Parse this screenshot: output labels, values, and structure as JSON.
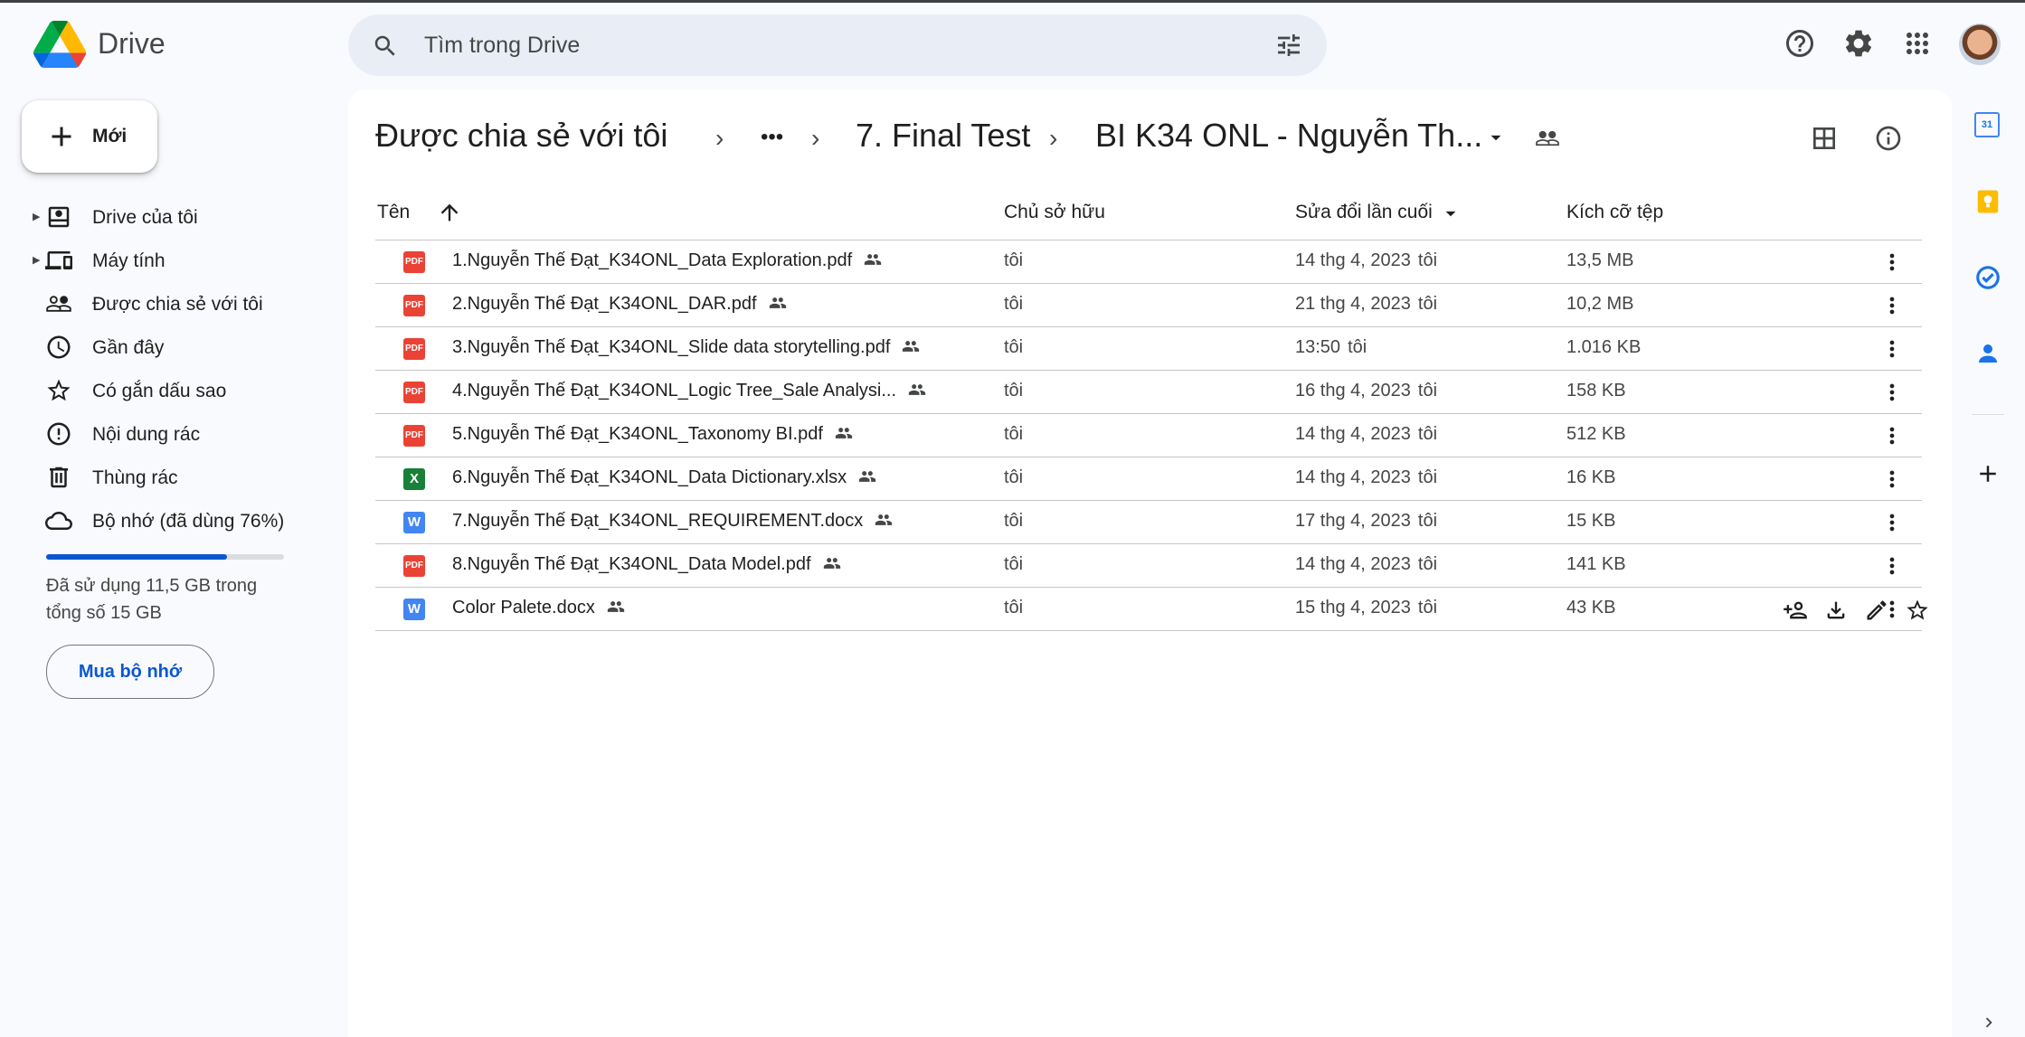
{
  "app": {
    "name": "Drive"
  },
  "search": {
    "placeholder": "Tìm trong Drive"
  },
  "header_icons": [
    "help-icon",
    "settings-icon",
    "apps-grid-icon",
    "account-avatar"
  ],
  "new_button": {
    "label": "Mới"
  },
  "sidebar": {
    "items": [
      {
        "label": "Drive của tôi",
        "icon": "my-drive-icon",
        "expandable": true
      },
      {
        "label": "Máy tính",
        "icon": "computers-icon",
        "expandable": true
      },
      {
        "label": "Được chia sẻ với tôi",
        "icon": "shared-icon",
        "expandable": false
      },
      {
        "label": "Gần đây",
        "icon": "clock-icon",
        "expandable": false
      },
      {
        "label": "Có gắn dấu sao",
        "icon": "star-icon",
        "expandable": false
      },
      {
        "label": "Nội dung rác",
        "icon": "spam-icon",
        "expandable": false
      },
      {
        "label": "Thùng rác",
        "icon": "trash-icon",
        "expandable": false
      },
      {
        "label": "Bộ nhớ (đã dùng 76%)",
        "icon": "cloud-icon",
        "expandable": false
      }
    ],
    "storage": {
      "used_fraction": 0.76,
      "text": "Đã sử dụng 11,5 GB trong tổng số 15 GB",
      "buy_label": "Mua bộ nhớ"
    }
  },
  "breadcrumb": {
    "root": "Được chia sẻ với tôi",
    "ellipsis": "•••",
    "folder": "7. Final Test",
    "current": "BI K34 ONL - Nguyễn Th..."
  },
  "columns": {
    "name": "Tên",
    "owner": "Chủ sở hữu",
    "modified": "Sửa đổi lần cuối",
    "size": "Kích cỡ tệp"
  },
  "files": [
    {
      "name": "1.Nguyễn Thế Đạt_K34ONL_Data Exploration.pdf",
      "type": "pdf",
      "owner": "tôi",
      "modified": "14 thg 4, 2023",
      "modified_by": "tôi",
      "size": "13,5 MB"
    },
    {
      "name": "2.Nguyễn Thế Đạt_K34ONL_DAR.pdf",
      "type": "pdf",
      "owner": "tôi",
      "modified": "21 thg 4, 2023",
      "modified_by": "tôi",
      "size": "10,2 MB"
    },
    {
      "name": "3.Nguyễn Thế Đạt_K34ONL_Slide data storytelling.pdf",
      "type": "pdf",
      "owner": "tôi",
      "modified": "13:50",
      "modified_by": "tôi",
      "size": "1.016 KB"
    },
    {
      "name": "4.Nguyễn Thế Đạt_K34ONL_Logic Tree_Sale Analysi...",
      "type": "pdf",
      "owner": "tôi",
      "modified": "16 thg 4, 2023",
      "modified_by": "tôi",
      "size": "158 KB"
    },
    {
      "name": "5.Nguyễn Thế Đạt_K34ONL_Taxonomy BI.pdf",
      "type": "pdf",
      "owner": "tôi",
      "modified": "14 thg 4, 2023",
      "modified_by": "tôi",
      "size": "512 KB"
    },
    {
      "name": "6.Nguyễn Thế Đạt_K34ONL_Data Dictionary.xlsx",
      "type": "xlsx",
      "owner": "tôi",
      "modified": "14 thg 4, 2023",
      "modified_by": "tôi",
      "size": "16 KB"
    },
    {
      "name": "7.Nguyễn Thế Đạt_K34ONL_REQUIREMENT.docx",
      "type": "docx",
      "owner": "tôi",
      "modified": "17 thg 4, 2023",
      "modified_by": "tôi",
      "size": "15 KB"
    },
    {
      "name": "8.Nguyễn Thế Đạt_K34ONL_Data Model.pdf",
      "type": "pdf",
      "owner": "tôi",
      "modified": "14 thg 4, 2023",
      "modified_by": "tôi",
      "size": "141 KB"
    },
    {
      "name": "Color Palete.docx",
      "type": "docx",
      "owner": "tôi",
      "modified": "15 thg 4, 2023",
      "modified_by": "tôi",
      "size": "43 KB",
      "hovered": true
    }
  ],
  "file_type_badges": {
    "pdf": "PDF",
    "xlsx": "X",
    "docx": "W"
  },
  "file_type_colors": {
    "pdf": "#ea4335",
    "xlsx": "#188038",
    "docx": "#4285f4"
  },
  "side_panel": {
    "calendar_day": "31",
    "icons": [
      "calendar-icon",
      "keep-icon",
      "tasks-icon",
      "contacts-icon",
      "add-icon"
    ]
  },
  "colors": {
    "accent": "#0b57d0",
    "background": "#f8fafd",
    "search_bg": "#e9eef6"
  }
}
